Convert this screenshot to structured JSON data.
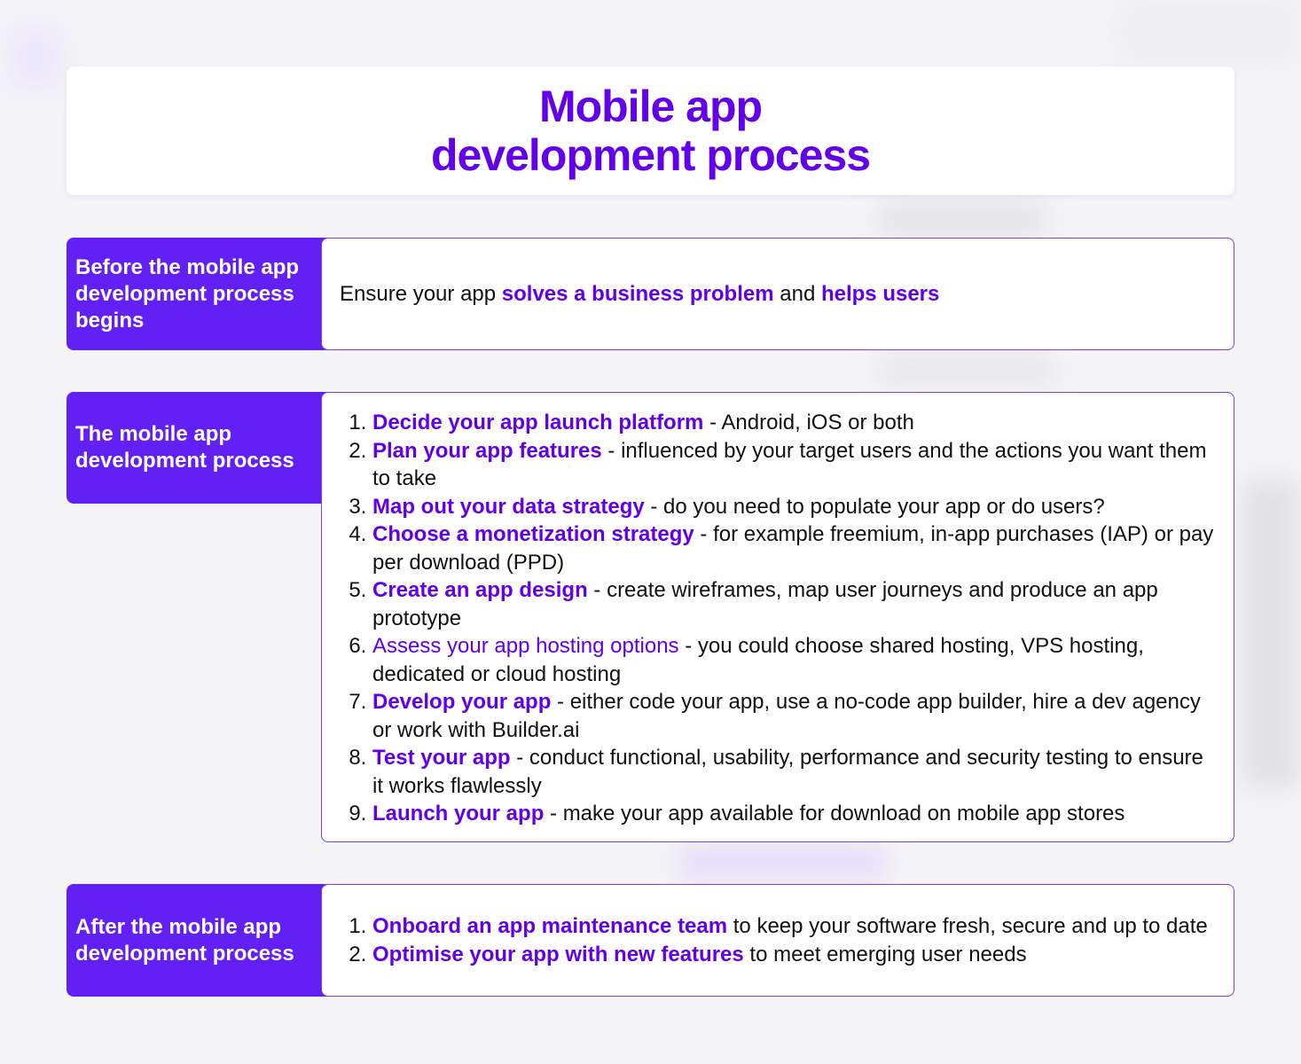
{
  "header": {
    "title_line1": "Mobile app",
    "title_line2": "development process"
  },
  "colors": {
    "accent": "#6200ea",
    "label_background": "#6320f5",
    "border": "#7d3cf0",
    "text": "#111111",
    "background": "#f5f4f7"
  },
  "sections": [
    {
      "label": "Before the mobile app development process begins",
      "content": {
        "prefix": "Ensure your app ",
        "highlight1": "solves a business problem",
        "middle": " and ",
        "highlight2": "helps users"
      }
    },
    {
      "label": "The mobile app development process",
      "steps": [
        {
          "highlight": "Decide your app launch platform",
          "text": " - Android, iOS or both"
        },
        {
          "highlight": "Plan your app features",
          "text": " - influenced by your target users and the actions you want them to take"
        },
        {
          "highlight": "Map out your data strategy",
          "text": " - do you need to populate your app or do users?"
        },
        {
          "highlight": "Choose a monetization strategy",
          "text": " - for example freemium, in-app purchases (IAP) or pay per download (PPD)"
        },
        {
          "highlight": "Create an app design",
          "text": " - create wireframes, map user journeys and produce an app prototype"
        },
        {
          "highlight": "Assess your app hosting options",
          "text": " - you could choose shared hosting, VPS hosting, dedicated or cloud hosting"
        },
        {
          "highlight": "Develop your app",
          "text": " - either code your app, use a no-code app builder, hire a dev agency or work with Builder.ai"
        },
        {
          "highlight": "Test your app",
          "text": " - conduct functional, usability, performance and security testing to ensure it works flawlessly"
        },
        {
          "highlight": "Launch your app",
          "text": " - make your app available for download on mobile app stores"
        }
      ]
    },
    {
      "label": "After the mobile app development process",
      "steps": [
        {
          "highlight": "Onboard an app maintenance team",
          "text": " to keep your software fresh, secure and up to date"
        },
        {
          "highlight": "Optimise your app with new features",
          "text": " to meet emerging user needs"
        }
      ]
    }
  ]
}
